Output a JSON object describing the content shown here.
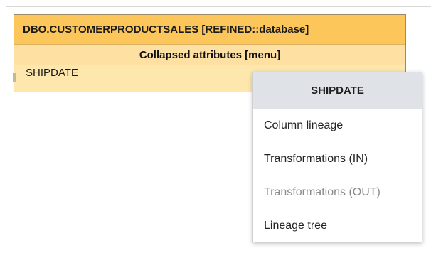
{
  "entity": {
    "title": "DBO.CUSTOMERPRODUCTSALES [REFINED::database]",
    "subheader": "Collapsed attributes [menu]",
    "rows": [
      "SHIPDATE"
    ]
  },
  "context_menu": {
    "title": "SHIPDATE",
    "items": [
      {
        "label": "Column lineage",
        "enabled": true
      },
      {
        "label": "Transformations (IN)",
        "enabled": true
      },
      {
        "label": "Transformations (OUT)",
        "enabled": false
      },
      {
        "label": "Lineage tree",
        "enabled": true
      }
    ]
  },
  "colors": {
    "header_bg": "#fcc65a",
    "body_bg": "#fde7ad",
    "menu_header_bg": "#dfe2e6",
    "disabled_text": "#8a8a8a"
  }
}
